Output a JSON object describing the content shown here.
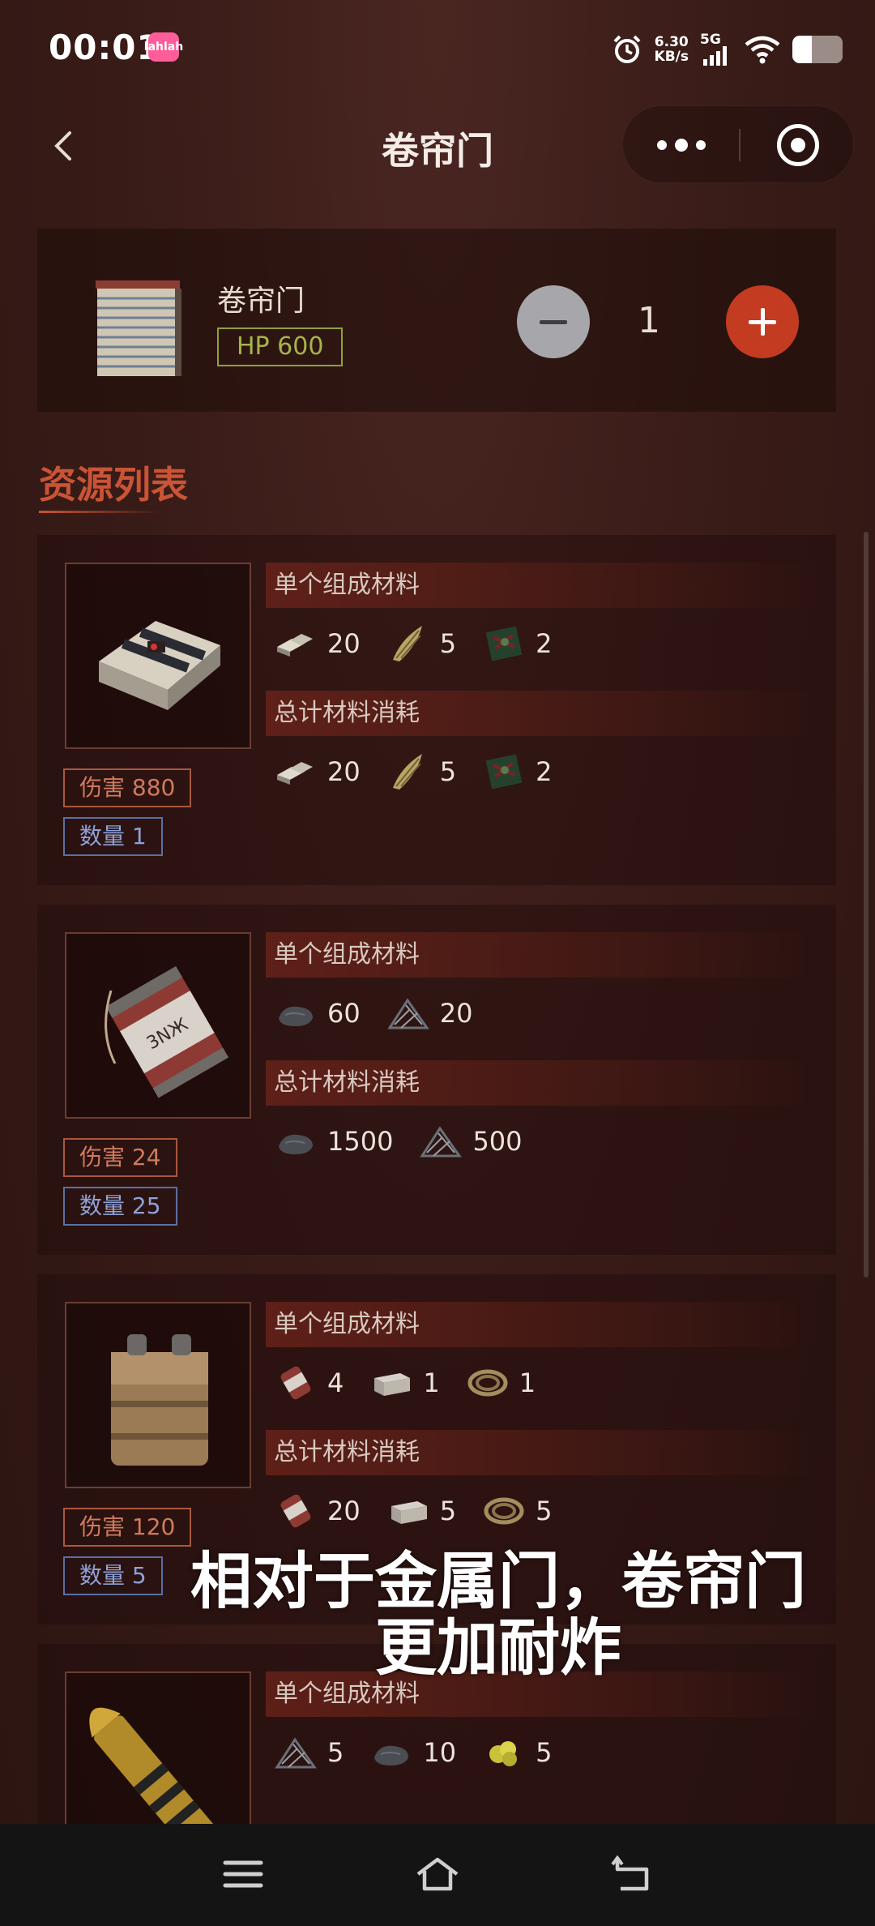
{
  "status_bar": {
    "time": "00:01",
    "app_badge": "lahlah",
    "net_speed_value": "6.30",
    "net_speed_unit": "KB/s",
    "network": "5G"
  },
  "nav": {
    "title": "卷帘门"
  },
  "item": {
    "name": "卷帘门",
    "hp": "HP 600",
    "quantity": "1"
  },
  "section_title": "资源列表",
  "resources": [
    {
      "damage": "伤害 880",
      "count": "数量 1",
      "single_label": "单个组成材料",
      "total_label": "总计材料消耗",
      "single": [
        {
          "icon": "metal-fragments-icon",
          "qty": "20"
        },
        {
          "icon": "cloth-icon",
          "qty": "5"
        },
        {
          "icon": "tech-trash-icon",
          "qty": "2"
        }
      ],
      "total": [
        {
          "icon": "metal-fragments-icon",
          "qty": "20"
        },
        {
          "icon": "cloth-icon",
          "qty": "5"
        },
        {
          "icon": "tech-trash-icon",
          "qty": "2"
        }
      ]
    },
    {
      "damage": "伤害 24",
      "count": "数量 25",
      "single_label": "单个组成材料",
      "total_label": "总计材料消耗",
      "single": [
        {
          "icon": "charcoal-icon",
          "qty": "60"
        },
        {
          "icon": "sulfur-icon",
          "qty": "20"
        }
      ],
      "total": [
        {
          "icon": "charcoal-icon",
          "qty": "1500"
        },
        {
          "icon": "sulfur-icon",
          "qty": "500"
        }
      ]
    },
    {
      "damage": "伤害 120",
      "count": "数量 5",
      "single_label": "单个组成材料",
      "total_label": "总计材料消耗",
      "single": [
        {
          "icon": "beancan-grenade-icon",
          "qty": "4"
        },
        {
          "icon": "small-stash-icon",
          "qty": "1"
        },
        {
          "icon": "rope-icon",
          "qty": "1"
        }
      ],
      "total": [
        {
          "icon": "beancan-grenade-icon",
          "qty": "20"
        },
        {
          "icon": "small-stash-icon",
          "qty": "5"
        },
        {
          "icon": "rope-icon",
          "qty": "5"
        }
      ]
    },
    {
      "single_label": "单个组成材料",
      "single": [
        {
          "icon": "sulfur-icon",
          "qty": "5"
        },
        {
          "icon": "charcoal-icon",
          "qty": "10"
        },
        {
          "icon": "sulfur-ore-icon",
          "qty": "5"
        }
      ]
    }
  ],
  "subtitle": "相对于金属门，卷帘门更加耐炸",
  "colors": {
    "accent": "#c33c22",
    "hp_green": "#a6b44a",
    "damage": "#d07a5c",
    "count_blue": "#8fa1d6"
  }
}
